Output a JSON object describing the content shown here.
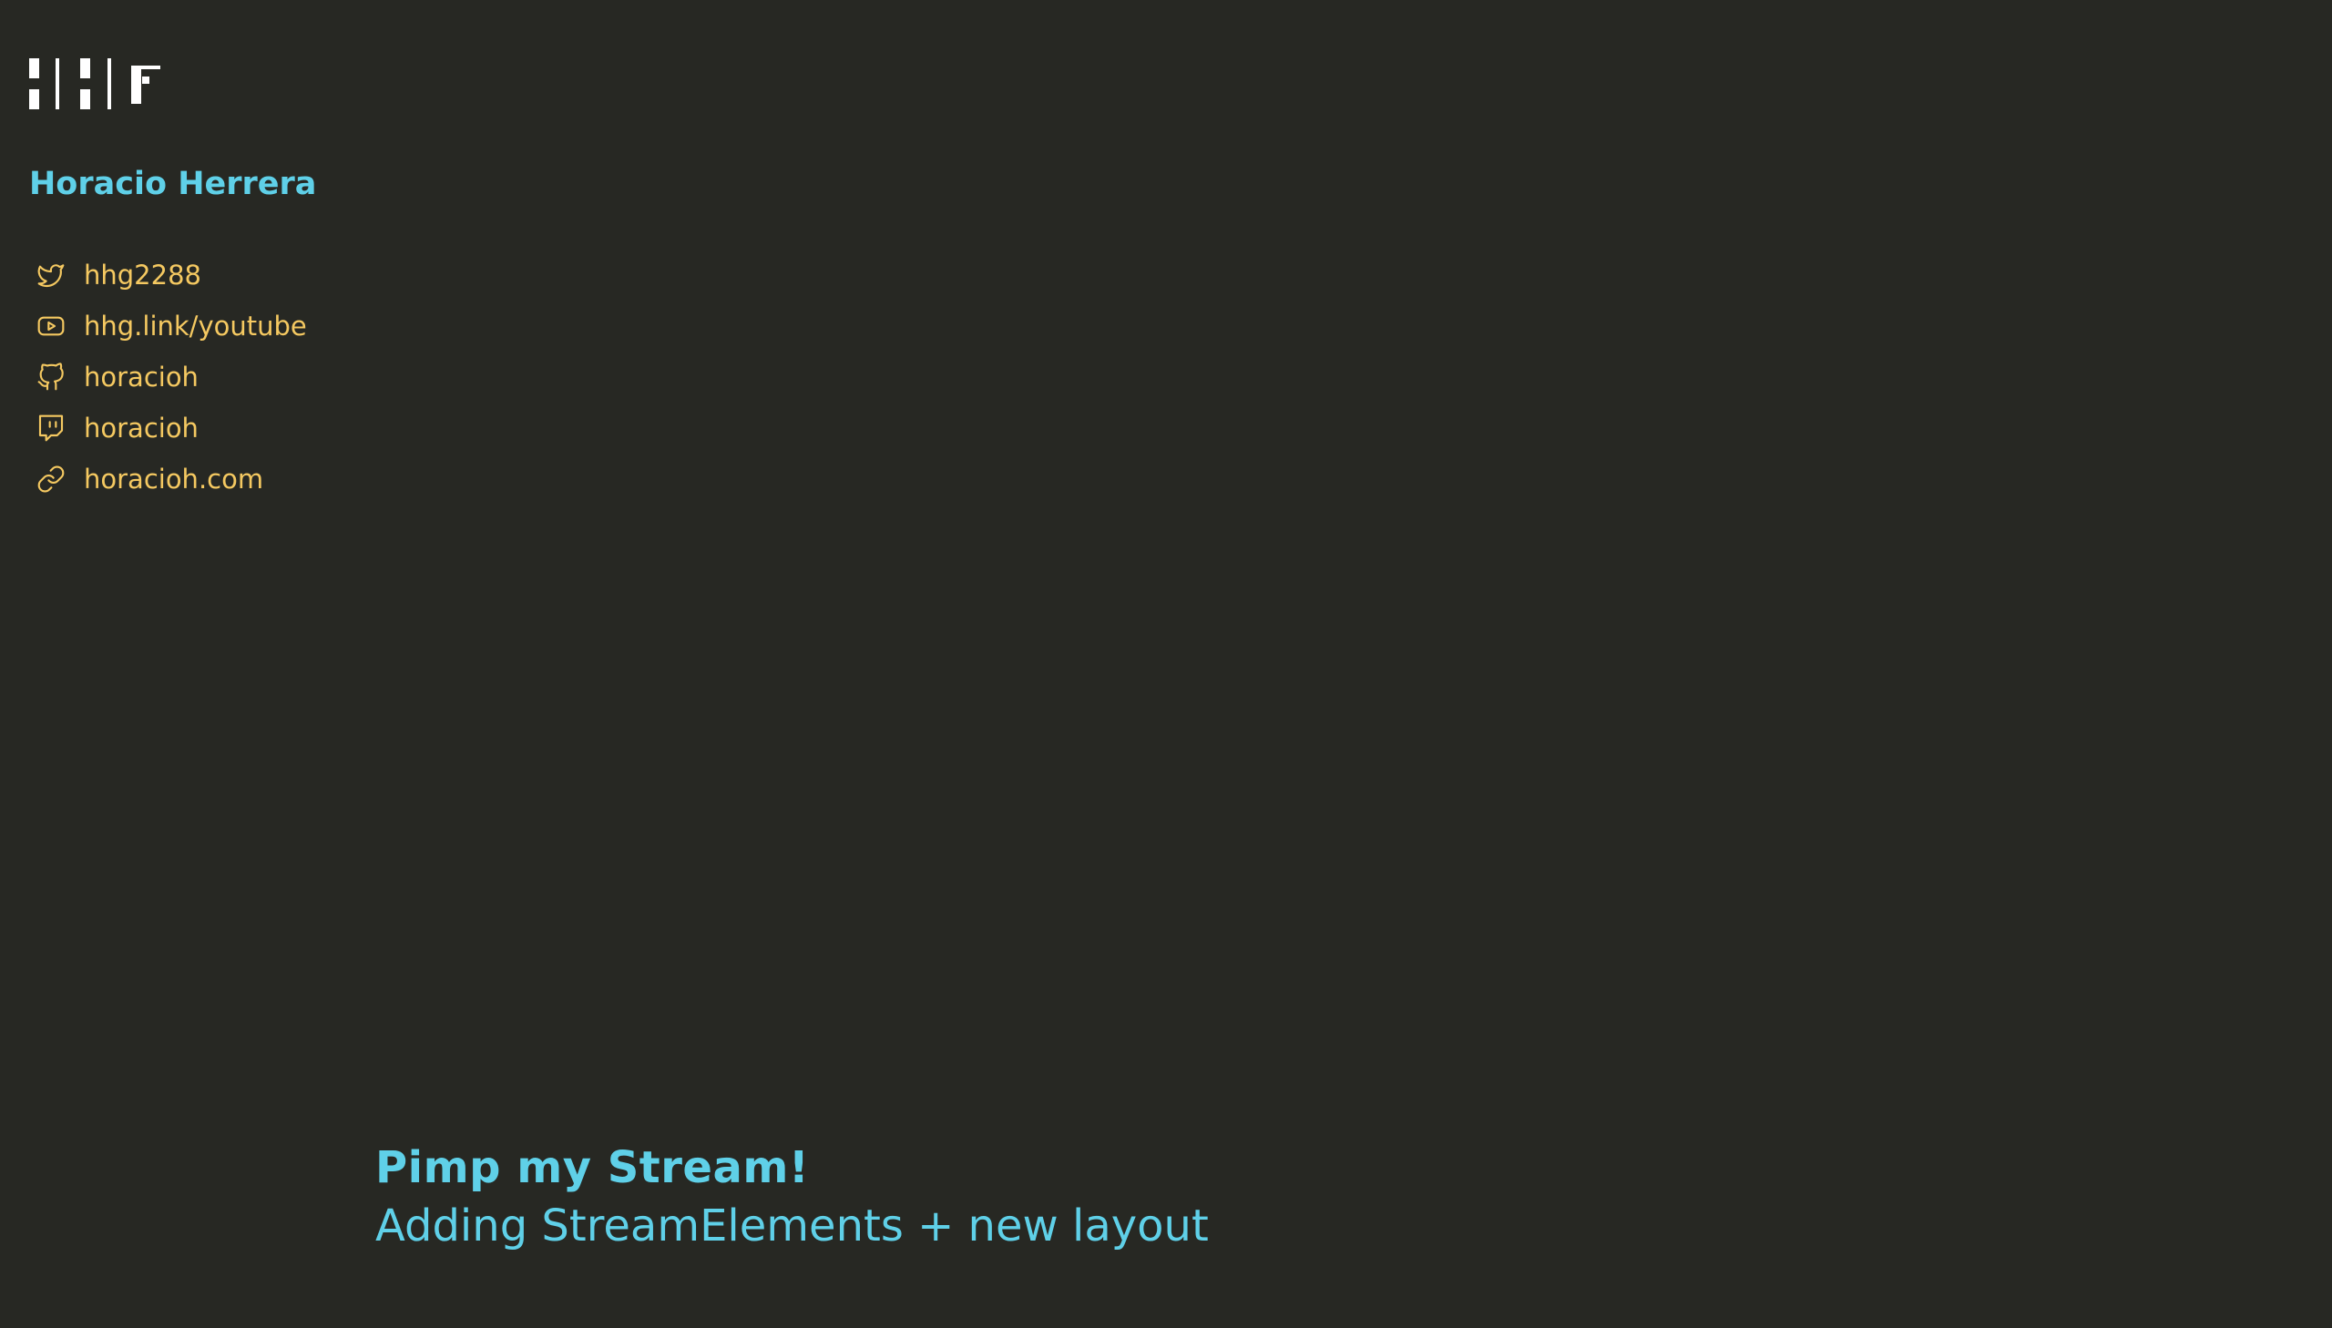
{
  "colors": {
    "background": "#272823",
    "accent_blue": "#5fd0e8",
    "accent_yellow": "#f5c961",
    "logo": "#ffffff"
  },
  "logo": {
    "icon": "hhg-logo-icon"
  },
  "author": {
    "name": "Horacio Herrera"
  },
  "links": [
    {
      "icon": "twitter-icon",
      "label": "hhg2288"
    },
    {
      "icon": "youtube-icon",
      "label": "hhg.link/youtube"
    },
    {
      "icon": "github-icon",
      "label": "horacioh"
    },
    {
      "icon": "twitch-icon",
      "label": "horacioh"
    },
    {
      "icon": "link-icon",
      "label": "horacioh.com"
    }
  ],
  "stream": {
    "title": "Pimp my Stream!",
    "subtitle": "Adding StreamElements + new layout"
  }
}
